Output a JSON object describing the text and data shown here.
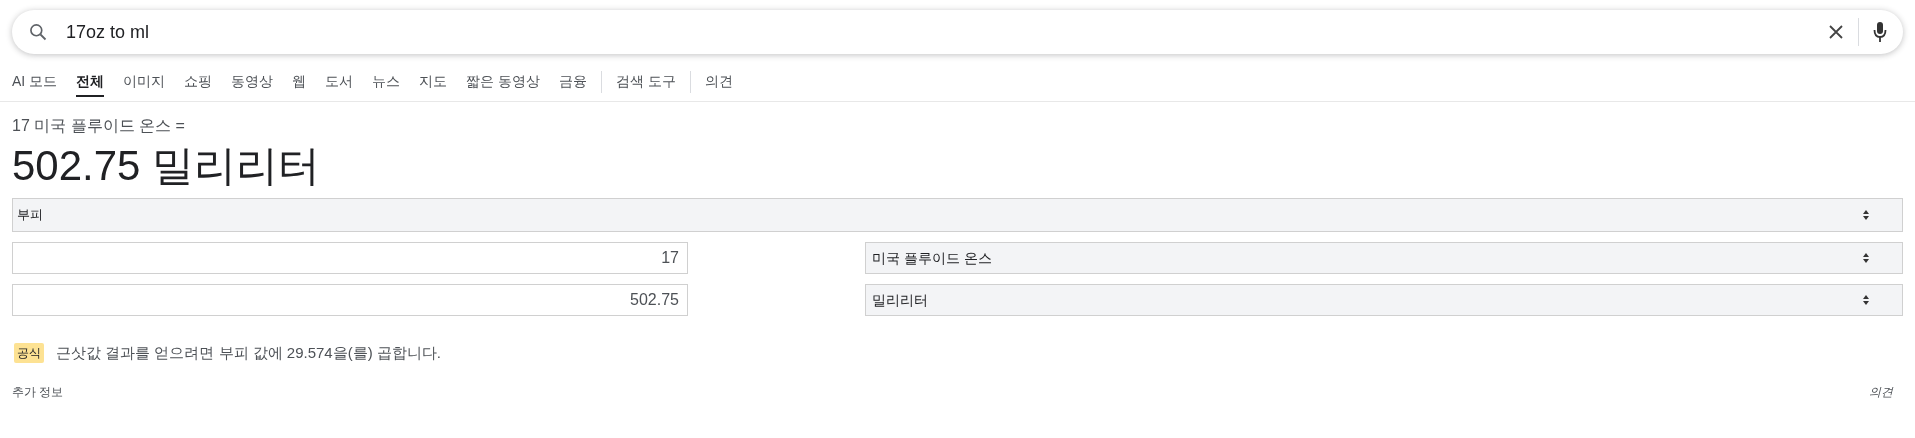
{
  "search": {
    "value": "17oz to ml"
  },
  "tabs": [
    {
      "label": "AI 모드",
      "selected": false
    },
    {
      "label": "전체",
      "selected": true
    },
    {
      "label": "이미지",
      "selected": false
    },
    {
      "label": "쇼핑",
      "selected": false
    },
    {
      "label": "동영상",
      "selected": false
    },
    {
      "label": "웹",
      "selected": false
    },
    {
      "label": "도서",
      "selected": false
    },
    {
      "label": "뉴스",
      "selected": false
    },
    {
      "label": "지도",
      "selected": false
    },
    {
      "label": "짧은 동영상",
      "selected": false
    },
    {
      "label": "금융",
      "selected": false
    }
  ],
  "tools_button": "검색 도구",
  "feedback_tab": "의견",
  "converter": {
    "question": "17 미국 플루이드 온스 =",
    "answer": "502.75 밀리리터",
    "category": "부피",
    "rows": [
      {
        "value": "17",
        "unit": "미국 플루이드 온스"
      },
      {
        "value": "502.75",
        "unit": "밀리리터"
      }
    ],
    "formula_badge": "공식",
    "formula": "근삿값 결과를 얻으려면 부피 값에 29.574을(를) 곱합니다."
  },
  "footer": {
    "more_info": "추가 정보",
    "feedback": "의견"
  }
}
